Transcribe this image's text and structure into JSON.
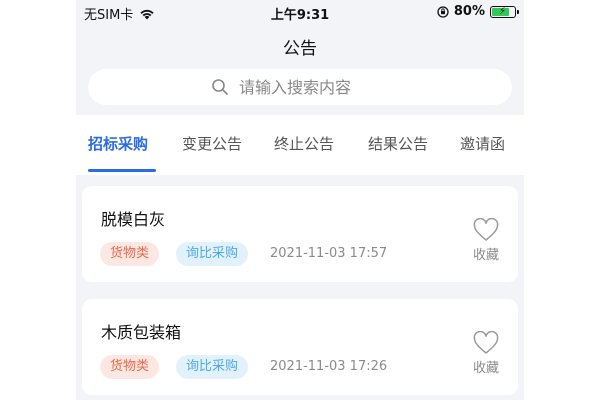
{
  "statusbar": {
    "carrier": "无SIM卡",
    "time": "上午9:31",
    "battery": "80%",
    "battery_level": 0.8,
    "icons": [
      "wifi-icon",
      "orientation-lock-icon",
      "battery-charging-icon"
    ]
  },
  "header": {
    "title": "公告"
  },
  "search": {
    "placeholder": "请输入搜索内容",
    "value": ""
  },
  "tabs": [
    {
      "label": "招标采购",
      "active": true
    },
    {
      "label": "变更公告",
      "active": false
    },
    {
      "label": "终止公告",
      "active": false
    },
    {
      "label": "结果公告",
      "active": false
    },
    {
      "label": "邀请函",
      "active": false
    }
  ],
  "colors": {
    "accent": "#2b6ce5",
    "goods_tag_bg": "#fde7e2",
    "goods_tag_text": "#e56b4d",
    "method_tag_bg": "#e1f2fd",
    "method_tag_text": "#52a8e0",
    "background": "#f2f4f7"
  },
  "items": [
    {
      "title": "脱模白灰",
      "category": "货物类",
      "method": "询比采购",
      "time": "2021-11-03 17:57",
      "fav_label": "收藏",
      "fav_icon": "heart-outline-icon"
    },
    {
      "title": "木质包装箱",
      "category": "货物类",
      "method": "询比采购",
      "time": "2021-11-03 17:26",
      "fav_label": "收藏",
      "fav_icon": "heart-outline-icon"
    }
  ]
}
